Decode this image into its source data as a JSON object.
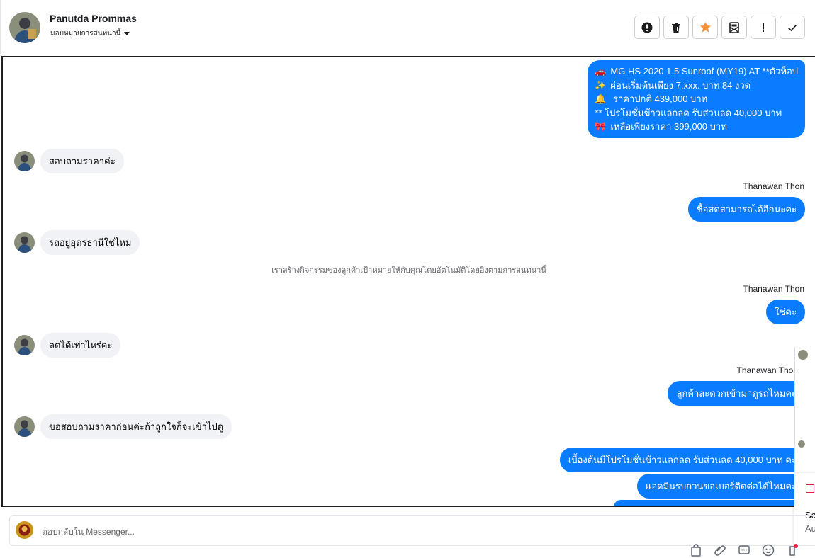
{
  "header": {
    "name": "Panutda Prommas",
    "subtitle": "มอบหมายการสนทนานี้",
    "actions": [
      {
        "name": "spam-icon",
        "label": "!"
      },
      {
        "name": "trash-icon"
      },
      {
        "name": "star-icon"
      },
      {
        "name": "mark-unread-icon"
      },
      {
        "name": "follow-up-icon",
        "label": "!"
      },
      {
        "name": "done-check-icon"
      }
    ],
    "accent": "#0a7cff",
    "star_color": "#f7923b"
  },
  "chat": {
    "promo_lines": [
      {
        "emoji": "🚗",
        "text": "MG HS 2020 1.5 Sunroof (MY19) AT **ตัวท็อป"
      },
      {
        "emoji": "✨",
        "text": "ผ่อนเริ่มต้นเพียง 7,xxx. บาท 84 งวด"
      },
      {
        "emoji": "🔔",
        "text": " ราคาปกติ 439,000 บาท"
      },
      {
        "emoji": "",
        "text": "** โปรโมชั่นข้าวแลกลด รับส่วนลด 40,000 บาท"
      },
      {
        "emoji": "🎀",
        "text": "เหลือเพียงราคา 399,000 บาท"
      }
    ],
    "messages": [
      {
        "side": "in",
        "text": "สอบถามราคาค่ะ"
      },
      {
        "side": "out",
        "sender": "Thanawan Thon",
        "text": "ซื้อสดสามารถได้อีกนะคะ"
      },
      {
        "side": "in",
        "text": "รถอยู่อุดรธานีใช่ไหม"
      },
      {
        "side": "out",
        "sender": "Thanawan Thon",
        "text": "ใช่คะ"
      },
      {
        "side": "in",
        "text": "ลดได้เท่าไหร่คะ"
      },
      {
        "side": "out",
        "sender": "Thanawan Thon",
        "text": "ลูกค้าสะดวกเข้ามาดูรถไหมคะ"
      },
      {
        "side": "in",
        "text": "ขอสอบถามราคาก่อนค่ะถ้าถูกใจก็จะเข้าไปดู"
      },
      {
        "side": "out",
        "text": "เบื้องต้นมีโปรโมชั่นข้าวแลกลด รับส่วนลด 40,000 บาท คะ"
      },
      {
        "side": "out",
        "text": "แอดมินรบกวนขอเบอร์ติดต่อได้ไหมคะ"
      }
    ],
    "system_note": "เราสร้างกิจกรรมของลูกค้าเป้าหมายให้กับคุณโดยอัตโนมัติโดยอิงตามการสนทนานี้"
  },
  "side_panel": {
    "line1": "Sc",
    "line2": "Au"
  },
  "reply": {
    "placeholder": "ตอบกลับใน Messenger..."
  }
}
